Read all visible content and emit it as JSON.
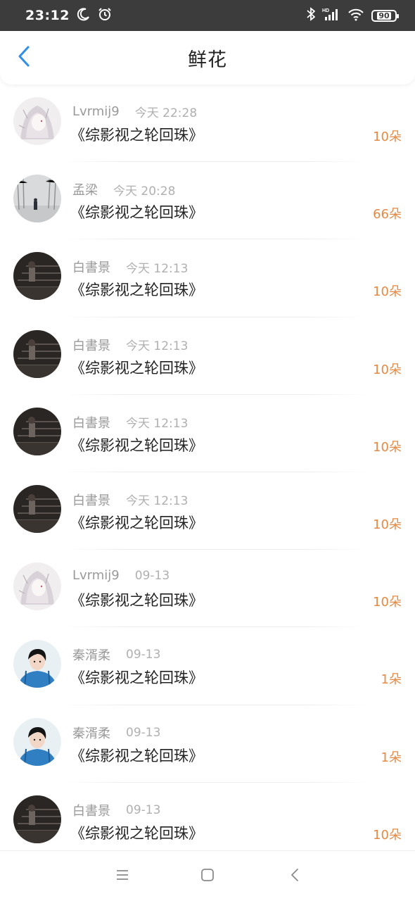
{
  "status_bar": {
    "time": "23:12",
    "battery": "90",
    "icons": [
      "moon-icon",
      "alarm-icon",
      "bluetooth-icon",
      "hd-signal-icon",
      "wifi-icon",
      "battery-icon"
    ]
  },
  "header": {
    "title": "鲜花",
    "back_icon": "chevron-left-icon",
    "accent_color": "#2f8ee5"
  },
  "colors": {
    "count": "#e58a44",
    "meta": "#9a9a9a",
    "title": "#222222"
  },
  "records": [
    {
      "user": "Lvrmij9",
      "time": "今天 22:28",
      "book": "《综影视之轮回珠》",
      "count": "10朵",
      "avatar": "anime-girl-avatar"
    },
    {
      "user": "孟梁",
      "time": "今天 20:28",
      "book": "《综影视之轮回珠》",
      "count": "66朵",
      "avatar": "misty-street-avatar"
    },
    {
      "user": "白書景",
      "time": "今天 12:13",
      "book": "《综影视之轮回珠》",
      "count": "10朵",
      "avatar": "stairs-figure-avatar"
    },
    {
      "user": "白書景",
      "time": "今天 12:13",
      "book": "《综影视之轮回珠》",
      "count": "10朵",
      "avatar": "stairs-figure-avatar"
    },
    {
      "user": "白書景",
      "time": "今天 12:13",
      "book": "《综影视之轮回珠》",
      "count": "10朵",
      "avatar": "stairs-figure-avatar"
    },
    {
      "user": "白書景",
      "time": "今天 12:13",
      "book": "《综影视之轮回珠》",
      "count": "10朵",
      "avatar": "stairs-figure-avatar"
    },
    {
      "user": "Lvrmij9",
      "time": "09-13",
      "book": "《综影视之轮回珠》",
      "count": "10朵",
      "avatar": "anime-girl-avatar"
    },
    {
      "user": "秦湑柔",
      "time": "09-13",
      "book": "《综影视之轮回珠》",
      "count": "1朵",
      "avatar": "portrait-blue-avatar"
    },
    {
      "user": "秦湑柔",
      "time": "09-13",
      "book": "《综影视之轮回珠》",
      "count": "1朵",
      "avatar": "portrait-blue-avatar"
    },
    {
      "user": "白書景",
      "time": "09-13",
      "book": "《综影视之轮回珠》",
      "count": "10朵",
      "avatar": "stairs-figure-avatar"
    }
  ],
  "nav_bar": {
    "icons": [
      "menu-icon",
      "home-square-icon",
      "back-triangle-icon"
    ]
  }
}
